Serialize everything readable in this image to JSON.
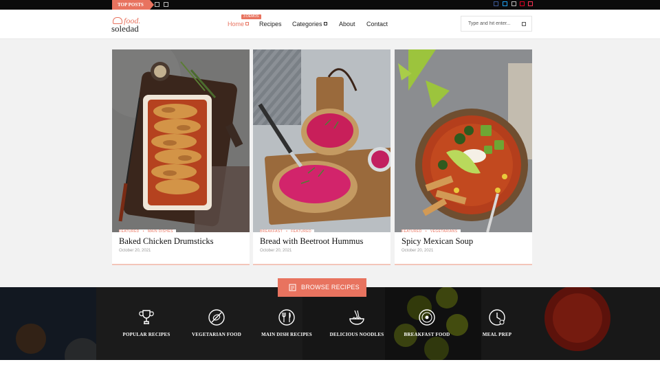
{
  "topbar": {
    "top_posts_label": "TOP POSTS",
    "nav_icons": [
      "prev-arrow-icon",
      "next-arrow-icon"
    ],
    "social": [
      {
        "name": "facebook-icon",
        "color": "#3b5998"
      },
      {
        "name": "twitter-icon",
        "color": "#1da1f2"
      },
      {
        "name": "instagram-icon",
        "color": "#bbbbbb"
      },
      {
        "name": "pinterest-icon",
        "color": "#e60023"
      },
      {
        "name": "youtube-icon",
        "color": "#ff3355"
      }
    ]
  },
  "header": {
    "logo_food": "food.",
    "logo_name": "soledad",
    "nav": [
      {
        "label": "Home",
        "active": true,
        "has_dropdown": true
      },
      {
        "label": "Recipes",
        "active": false,
        "has_dropdown": false
      },
      {
        "label": "Categories",
        "active": false,
        "has_dropdown": true
      },
      {
        "label": "About",
        "active": false,
        "has_dropdown": false
      },
      {
        "label": "Contact",
        "active": false,
        "has_dropdown": false
      }
    ],
    "demos_badge": "3 DEMOS",
    "search_placeholder": "Type and hit enter..."
  },
  "cards": [
    {
      "categories": [
        "FEATURED",
        "MAIN DISHES"
      ],
      "title": "Baked Chicken Drumsticks",
      "date": "October 20, 2021"
    },
    {
      "categories": [
        "BREAKFAST",
        "FEATURED"
      ],
      "title": "Bread with Beetroot Hummus",
      "date": "October 20, 2021"
    },
    {
      "categories": [
        "FEATURED",
        "VEGETARIANS"
      ],
      "title": "Spicy Mexican Soup",
      "date": "October 20, 2021"
    }
  ],
  "browse_button": "BROWSE RECIPES",
  "features": [
    {
      "label": "POPULAR RECIPES",
      "icon": "trophy-icon"
    },
    {
      "label": "VEGETARIAN FOOD",
      "icon": "no-meat-icon"
    },
    {
      "label": "MAIN DISH RECIPES",
      "icon": "cutlery-icon"
    },
    {
      "label": "DELICIOUS NOODLES",
      "icon": "noodles-icon"
    },
    {
      "label": "BREAKFAST FOOD",
      "icon": "plate-icon"
    },
    {
      "label": "MEAL PREP",
      "icon": "clock-icon"
    }
  ],
  "colors": {
    "accent": "#e8735f",
    "topbar": "#0b0b0b"
  }
}
